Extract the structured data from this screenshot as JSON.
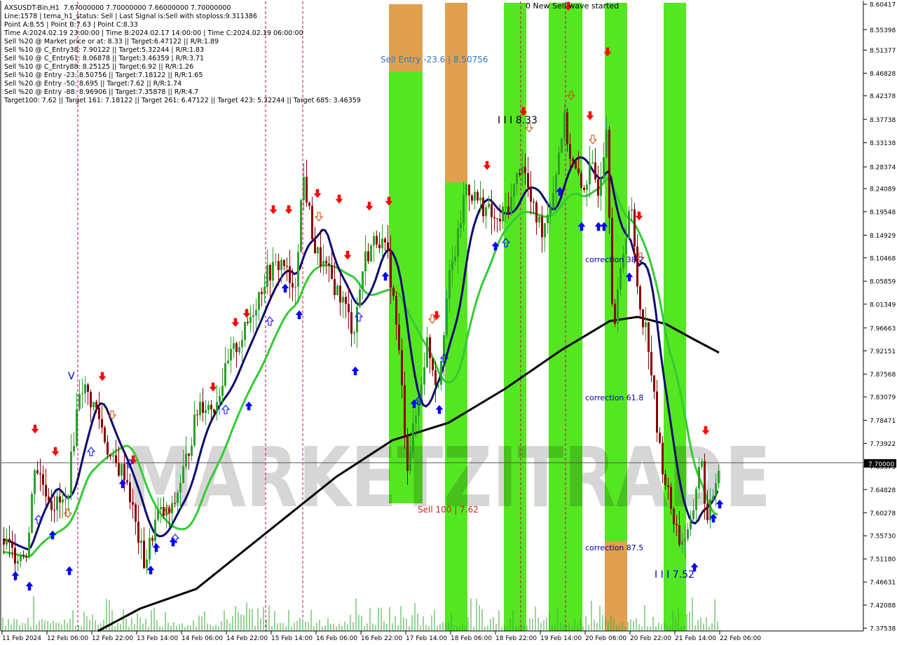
{
  "chart_data": {
    "type": "candlestick",
    "symbol": "AXSUSDT-Bin,H1",
    "ohlc_header": "7.67000000 7.70000000 7.66000000 7.70000000",
    "current_price": "7.70000",
    "info_lines": [
      "Line:1578 | tema_h1_status: Sell | Last Signal is:Sell with stoploss:9.311386",
      "Point A:8.55 | Point B:7.63 | Point C:8.33",
      "Time A:2024.02.19 23:00:00 | Time B:2024.02.17 14:00:00 | Time C:2024.02.19 06:00:00",
      "Sell %20 @ Market price or at: 8.33 || Target:6.47122 || R/R:1.89",
      "Sell %10 @ C_Entry38: 7.90122 || Target:5.32244 | R/R:1.83",
      "Sell %10 @ C_Entry61: 8.06878 || Target:3.46359 | R/R:3.71",
      "Sell %10 @ C_Entry88: 8.25125 || Target:6.92 || R/R:1.26",
      "Sell %10 @ Entry -23: 8.50756 || Target:7.18122 || R/R:1.65",
      "Sell %20 @ Entry -50: 8.695 || Target:7.62 || R/R:1.74",
      "Sell %20 @ Entry -88: 8.96906 || Target:7.35878 || R/R:4.7",
      "Target100: 7.62 || Target 161: 7.18122 || Target 261: 6.47122 || Target 423: 5.32244 || Target 685: 3.46359"
    ],
    "y_ticks": [
      "8.60417",
      "8.55398",
      "8.51377",
      "8.46828",
      "8.42378",
      "8.37738",
      "8.33138",
      "8.28374",
      "8.24089",
      "8.19548",
      "8.14929",
      "8.10468",
      "8.05859",
      "8.01349",
      "7.96663",
      "7.92151",
      "7.87568",
      "7.83079",
      "7.78471",
      "7.73922",
      "7.69373",
      "7.64828",
      "7.60278",
      "7.55730",
      "7.51180",
      "7.46631",
      "7.42088",
      "7.37538"
    ],
    "x_labels": [
      "11 Feb 2024",
      "12 Feb 06:00",
      "12 Feb 22:00",
      "13 Feb 14:00",
      "14 Feb 06:00",
      "14 Feb 22:00",
      "15 Feb 14:00",
      "16 Feb 06:00",
      "16 Feb 22:00",
      "17 Feb 14:00",
      "18 Feb 06:00",
      "18 Feb 22:00",
      "19 Feb 14:00",
      "20 Feb 06:00",
      "20 Feb 22:00",
      "21 Feb 14:00",
      "22 Feb 06:00"
    ],
    "annotations": {
      "sell_entry": "Sell Entry -23.6 | 8.50756",
      "sell_100": "Sell 100 | 7.62",
      "new_sell_wave": "0 New Sell wave started",
      "point_c": "I I I 8.33",
      "point_b": "I I I 7.52",
      "v_mark": "V",
      "correction_38": "correction 38.2",
      "correction_61": "correction 61.8",
      "correction_87": "correction 87.5"
    },
    "watermark": "MARKETZITRADE",
    "ylim": [
      7.375,
      8.604
    ],
    "colors": {
      "bull": "#2ca02c",
      "bear": "#8b0000",
      "tema": "#0a0a6e",
      "ma_green": "#33cc33",
      "ma_black": "#000000",
      "zone_green": "#55e622",
      "zone_orange": "#e0a050",
      "arrow_up": "#0000ff",
      "arrow_down": "#ff0000"
    }
  }
}
